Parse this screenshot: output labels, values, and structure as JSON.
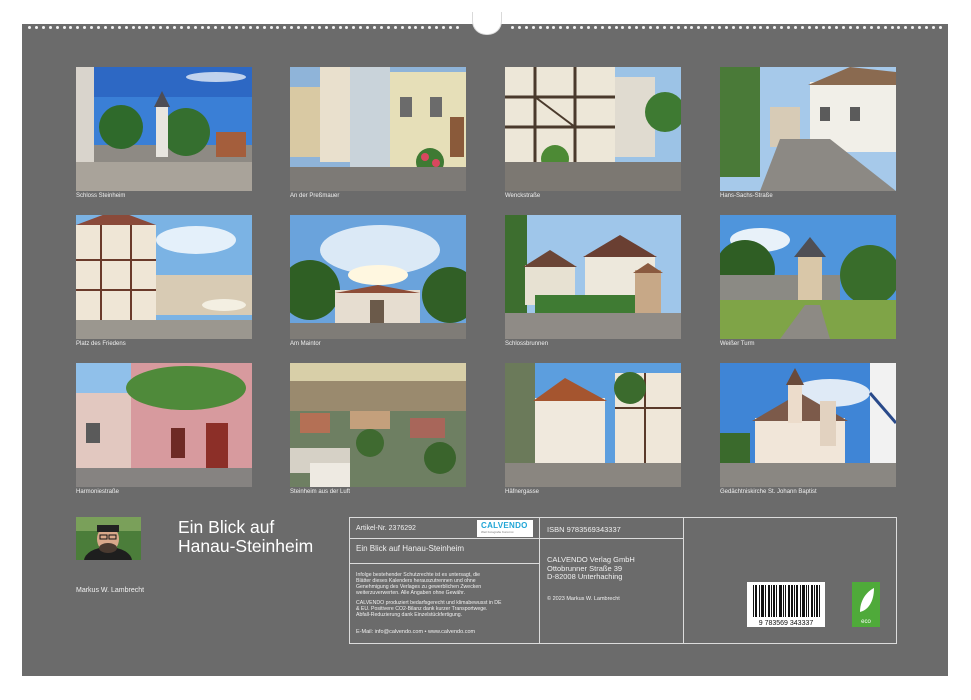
{
  "calendar": {
    "title_line1": "Ein Blick auf",
    "title_line2": "Hanau-Steinheim",
    "author": "Markus W. Lambrecht"
  },
  "photos": [
    {
      "caption": "Schloss Steinheim"
    },
    {
      "caption": "An der Preßmauer"
    },
    {
      "caption": "Wenckstraße"
    },
    {
      "caption": "Hans-Sachs-Straße"
    },
    {
      "caption": "Platz des Friedens"
    },
    {
      "caption": "Am Maintor"
    },
    {
      "caption": "Schlossbrunnen"
    },
    {
      "caption": "Weißer Turm"
    },
    {
      "caption": "Harmoniestraße"
    },
    {
      "caption": "Steinheim aus der Luft"
    },
    {
      "caption": "Häfnergasse"
    },
    {
      "caption": "Gedächtniskirche St. Johann Baptist"
    }
  ],
  "info": {
    "article_no": "Artikel-Nr. 2376292",
    "logo_text": "CALVENDO",
    "logo_sub": "Weil Fotografie Kunst ist",
    "product_title": "Ein Blick auf Hanau-Steinheim",
    "legal_text_1": [
      "Infolge bestehender Schutzrechte ist es untersagt, die",
      "Blätter dieses Kalenders herauszutrennen und ohne",
      "Genehmigung des Verlages zu gewerblichen Zwecken",
      "weiterzuverwerten. Alle Angaben ohne Gewähr."
    ],
    "legal_text_2": [
      "CALVENDO produziert bedarfsgerecht und klimabewusst in DE",
      "& EU. Positivere CO2-Bilanz dank kurzer Transportwege.",
      "Abfall-Reduzierung dank Einzelstückfertigung."
    ],
    "contact": "E-Mail: info@calvendo.com • www.calvendo.com",
    "isbn": "ISBN 9783569343337",
    "publisher": [
      "CALVENDO Verlag GmbH",
      "Ottobrunner Straße 39",
      "D-82008 Unterhaching"
    ],
    "copyright": "© 2023 Markus W. Lambrecht",
    "barcode_number": "9 783569 343337",
    "eco_label": "eco"
  },
  "colors": {
    "background": "#6b6b6b",
    "logo_blue": "#1fa5d6",
    "eco_green": "#4faa3a"
  }
}
